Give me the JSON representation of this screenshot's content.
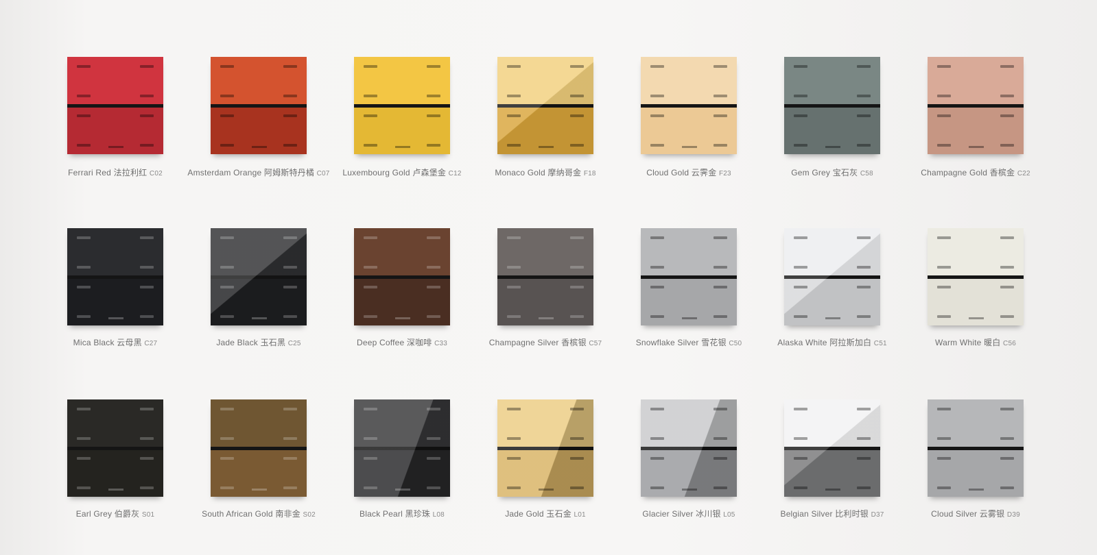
{
  "swatches": [
    {
      "name": "Ferrari Red",
      "cn": "法拉利红",
      "code": "C02",
      "colors": {
        "top": "#d0343f",
        "bottom": "#b52a33",
        "gloss": "none"
      },
      "dark_text": true
    },
    {
      "name": "Amsterdam Orange",
      "cn": "阿姆斯特丹橘",
      "code": "C07",
      "colors": {
        "top": "#d4532f",
        "bottom": "#a8331f",
        "gloss": "none"
      },
      "dark_text": true
    },
    {
      "name": "Luxembourg Gold",
      "cn": "卢森堡金",
      "code": "C12",
      "colors": {
        "top": "#f3c644",
        "bottom": "#e4b834",
        "gloss": "none"
      },
      "dark_text": true
    },
    {
      "name": "Monaco Gold",
      "cn": "摩纳哥金",
      "code": "F18",
      "colors": {
        "top": "#f1cf7c",
        "bottom": "#d9a53a",
        "gloss": "diag"
      },
      "dark_text": true
    },
    {
      "name": "Cloud Gold",
      "cn": "云霁金",
      "code": "F23",
      "colors": {
        "top": "#f3d9b0",
        "bottom": "#ecc995",
        "gloss": "none"
      },
      "dark_text": true
    },
    {
      "name": "Gem Grey",
      "cn": "宝石灰",
      "code": "C58",
      "colors": {
        "top": "#7a8784",
        "bottom": "#66716f",
        "gloss": "none"
      },
      "dark_text": true
    },
    {
      "name": "Champagne Gold",
      "cn": "香槟金",
      "code": "C22",
      "colors": {
        "top": "#d9aa98",
        "bottom": "#c69683",
        "gloss": "none"
      },
      "dark_text": true
    },
    {
      "name": "Mica Black",
      "cn": "云母黑",
      "code": "C27",
      "colors": {
        "top": "#2b2c2f",
        "bottom": "#1c1d20",
        "gloss": "none"
      },
      "dark_text": false
    },
    {
      "name": "Jade Black",
      "cn": "玉石黑",
      "code": "C25",
      "colors": {
        "top": "#2e2f31",
        "bottom": "#1e1f21",
        "gloss": "diag"
      },
      "dark_text": false
    },
    {
      "name": "Deep Coffee",
      "cn": "深咖啡",
      "code": "C33",
      "colors": {
        "top": "#6a4330",
        "bottom": "#4a2e22",
        "gloss": "none"
      },
      "dark_text": false
    },
    {
      "name": "Champagne Silver",
      "cn": "香槟银",
      "code": "C57",
      "colors": {
        "top": "#6e6866",
        "bottom": "#585352",
        "gloss": "none"
      },
      "dark_text": false
    },
    {
      "name": "Snowflake Silver",
      "cn": "雪花银",
      "code": "C50",
      "colors": {
        "top": "#b8b9bb",
        "bottom": "#a6a7a9",
        "gloss": "none"
      },
      "dark_text": true
    },
    {
      "name": "Alaska White",
      "cn": "阿拉斯加白",
      "code": "C51",
      "colors": {
        "top": "#ecedef",
        "bottom": "#d7d8da",
        "gloss": "diag"
      },
      "dark_text": true
    },
    {
      "name": "Warm White",
      "cn": "暖白",
      "code": "C56",
      "colors": {
        "top": "#ecebe2",
        "bottom": "#e3e1d7",
        "gloss": "none"
      },
      "dark_text": true
    },
    {
      "name": "Earl Grey",
      "cn": "伯爵灰",
      "code": "S01",
      "colors": {
        "top": "#2a2926",
        "bottom": "#24231f",
        "gloss": "none"
      },
      "dark_text": false
    },
    {
      "name": "South African Gold",
      "cn": "南非金",
      "code": "S02",
      "colors": {
        "top": "#6f5632",
        "bottom": "#7a5a33",
        "gloss": "none"
      },
      "dark_text": false
    },
    {
      "name": "Black Pearl",
      "cn": "黑珍珠",
      "code": "L08",
      "colors": {
        "top": "#3a3a3c",
        "bottom": "#2a2a2c",
        "gloss": "diag2"
      },
      "dark_text": false
    },
    {
      "name": "Jade Gold",
      "cn": "玉石金",
      "code": "L01",
      "colors": {
        "top": "#eccd84",
        "bottom": "#d9b466",
        "gloss": "diag2"
      },
      "dark_text": true
    },
    {
      "name": "Glacier Silver",
      "cn": "冰川银",
      "code": "L05",
      "colors": {
        "top": "#c9cacc",
        "bottom": "#9a9b9e",
        "gloss": "diag2"
      },
      "dark_text": true
    },
    {
      "name": "Belgian Silver",
      "cn": "比利时银",
      "code": "D37",
      "colors": {
        "top": "#f2f2f3",
        "bottom": "#777879",
        "gloss": "diag"
      },
      "dark_text": true
    },
    {
      "name": "Cloud Silver",
      "cn": "云雾银",
      "code": "D39",
      "colors": {
        "top": "#b6b7b9",
        "bottom": "#a6a7a9",
        "gloss": "none"
      },
      "dark_text": true
    }
  ]
}
